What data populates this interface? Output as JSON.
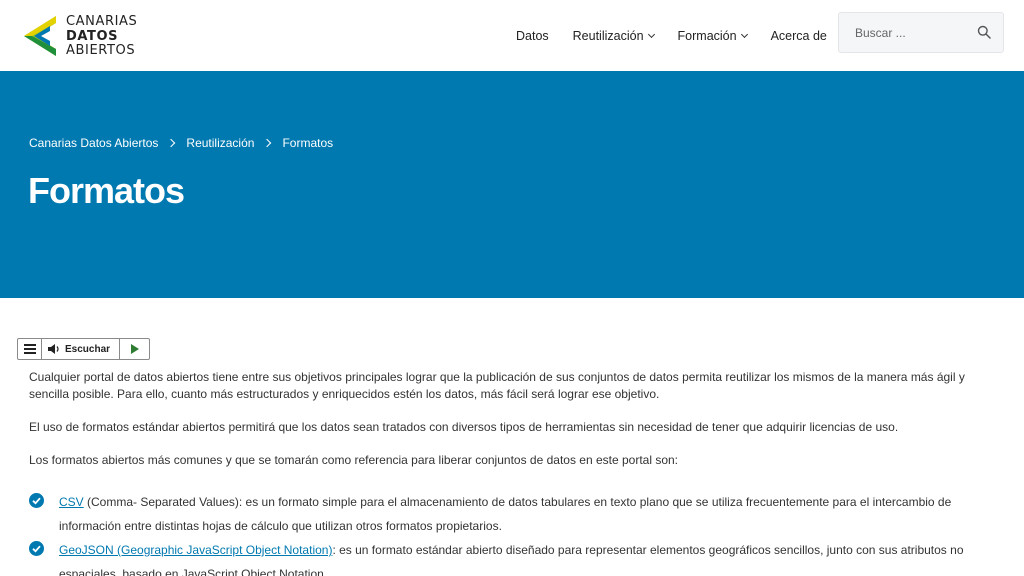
{
  "header": {
    "logo": {
      "line1": "CANARIAS",
      "line2": "DATOS",
      "line3": "ABIERTOS"
    },
    "nav": [
      {
        "label": "Datos",
        "dropdown": false
      },
      {
        "label": "Reutilización",
        "dropdown": true
      },
      {
        "label": "Formación",
        "dropdown": true
      },
      {
        "label": "Acerca de",
        "dropdown": false
      }
    ],
    "search": {
      "placeholder": "Buscar ..."
    }
  },
  "hero": {
    "breadcrumb": [
      "Canarias Datos Abiertos",
      "Reutilización",
      "Formatos"
    ],
    "title": "Formatos",
    "background": "#0079b0"
  },
  "listen": {
    "label": "Escuchar"
  },
  "content": {
    "p1": "Cualquier portal de datos abiertos tiene entre sus objetivos principales lograr que la publicación de sus conjuntos de datos permita reutilizar los mismos de la manera más ágil y sencilla posible. Para ello, cuanto más estructurados y enriquecidos estén los datos, más fácil será lograr ese objetivo.",
    "p2": "El uso de formatos estándar abiertos permitirá que los datos sean tratados con diversos tipos de herramientas sin necesidad de tener que adquirir licencias de uso.",
    "p3": "Los formatos abiertos más comunes y que se tomarán como referencia para liberar conjuntos de datos en este portal son:",
    "formats": [
      {
        "name": "CSV",
        "text": " (Comma- Separated Values): es un formato simple para el almacenamiento de datos tabulares en texto plano que se utiliza frecuentemente para el intercambio de información entre distintas hojas de cálculo que utilizan otros formatos propietarios."
      },
      {
        "name": "GeoJSON (Geographic JavaScript Object Notation)",
        "text": ": es un formato estándar abierto diseñado para representar elementos geográficos sencillos, junto con sus atributos no espaciales, basado en JavaScript Object Notation."
      }
    ]
  },
  "colors": {
    "accent": "#0079b0",
    "check": "#0079b0",
    "logo_yellow": "#e3d200",
    "logo_green": "#7ab51d"
  }
}
